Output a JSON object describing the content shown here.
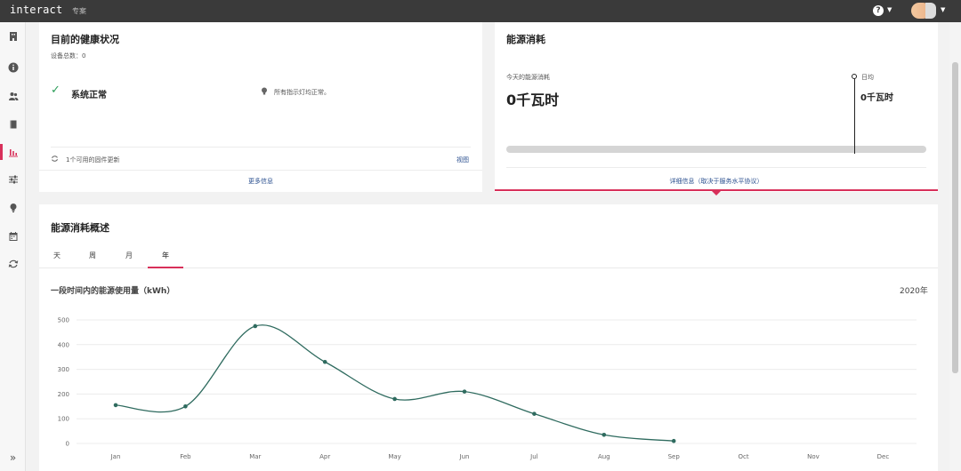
{
  "app": {
    "brand": "interact",
    "badge": "专案"
  },
  "topbar": {
    "help_icon": "help-icon"
  },
  "sidebar": {
    "items": [
      {
        "icon": "building-icon",
        "active": false
      },
      {
        "icon": "info-icon",
        "active": false
      },
      {
        "icon": "users-icon",
        "active": false
      },
      {
        "icon": "book-icon",
        "active": false
      },
      {
        "icon": "bar-chart-icon",
        "active": true
      },
      {
        "icon": "sliders-icon",
        "active": false
      },
      {
        "icon": "lightbulb-icon",
        "active": false
      },
      {
        "icon": "calendar-icon",
        "active": false
      },
      {
        "icon": "refresh-icon",
        "active": false
      }
    ],
    "expand_label": "»"
  },
  "health": {
    "title": "目前的健康状况",
    "device_total": "设备总数：0",
    "status": "系统正常",
    "indicator_text": "所有指示灯均正常。",
    "firmware": "1个可用的固件更新",
    "view_link": "视图",
    "more_info": "更多信息"
  },
  "energy": {
    "title": "能源消耗",
    "today_label": "今天的能源消耗",
    "today_value": "0千瓦时",
    "daily_avg_label": "日均",
    "daily_avg_value": "0千瓦时",
    "details_link": "详细信息（取决于服务水平协议）"
  },
  "overview": {
    "title": "能源消耗概述",
    "tabs": [
      "天",
      "周",
      "月",
      "年"
    ],
    "active_tab": "年",
    "chart_heading": "一段时间内的能源使用量（kWh）",
    "year": "2020年"
  },
  "colors": {
    "accent": "#d8305a",
    "line": "#2f6b5f",
    "check": "#2e9e5b"
  },
  "chart_data": {
    "type": "line",
    "title": "一段时间内的能源使用量（kWh）",
    "categories": [
      "Jan",
      "Feb",
      "Mar",
      "Apr",
      "May",
      "Jun",
      "Jul",
      "Aug",
      "Sep",
      "Oct",
      "Nov",
      "Dec"
    ],
    "values": [
      155,
      150,
      475,
      330,
      180,
      210,
      120,
      35,
      10,
      null,
      null,
      null
    ],
    "yticks": [
      0,
      100,
      200,
      300,
      400,
      500
    ],
    "ylim": [
      0,
      500
    ],
    "grid": true,
    "curve": "smooth"
  }
}
